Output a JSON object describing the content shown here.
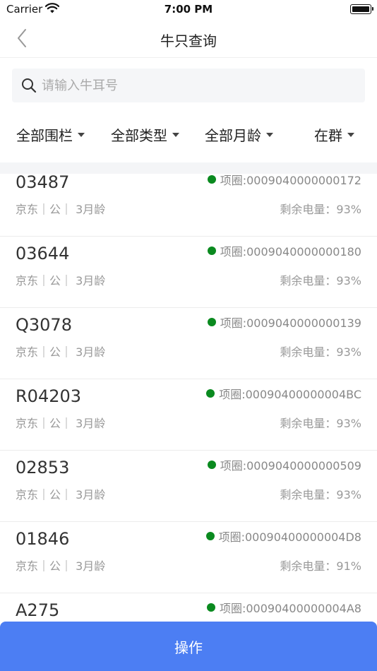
{
  "status_bar": {
    "carrier": "Carrier",
    "time": "7:00 PM"
  },
  "nav": {
    "title": "牛只查询"
  },
  "search": {
    "placeholder": "请输入牛耳号",
    "value": ""
  },
  "filters": [
    {
      "label": "全部围栏"
    },
    {
      "label": "全部类型"
    },
    {
      "label": "全部月龄"
    },
    {
      "label": "在群"
    }
  ],
  "rows": [
    {
      "id": "03487",
      "meta": "京东｜公｜ 3月龄",
      "collar": "项圈:0009040000000172",
      "battery": "剩余电量：93%"
    },
    {
      "id": "03644",
      "meta": "京东｜公｜ 3月龄",
      "collar": "项圈:0009040000000180",
      "battery": "剩余电量：93%"
    },
    {
      "id": "Q3078",
      "meta": "京东｜公｜ 3月龄",
      "collar": "项圈:0009040000000139",
      "battery": "剩余电量：93%"
    },
    {
      "id": "R04203",
      "meta": "京东｜公｜ 3月龄",
      "collar": "项圈:00090400000004BC",
      "battery": "剩余电量：93%"
    },
    {
      "id": "02853",
      "meta": "京东｜公｜ 3月龄",
      "collar": "项圈:0009040000000509",
      "battery": "剩余电量：93%"
    },
    {
      "id": "01846",
      "meta": "京东｜公｜ 3月龄",
      "collar": "项圈:00090400000004D8",
      "battery": "剩余电量：91%"
    },
    {
      "id": "A275",
      "meta": "",
      "collar": "项圈:00090400000004A8",
      "battery": ""
    }
  ],
  "colors": {
    "online_dot": "#0a8a1f",
    "action_bar": "#4c7ef3"
  },
  "action": {
    "label": "操作"
  }
}
